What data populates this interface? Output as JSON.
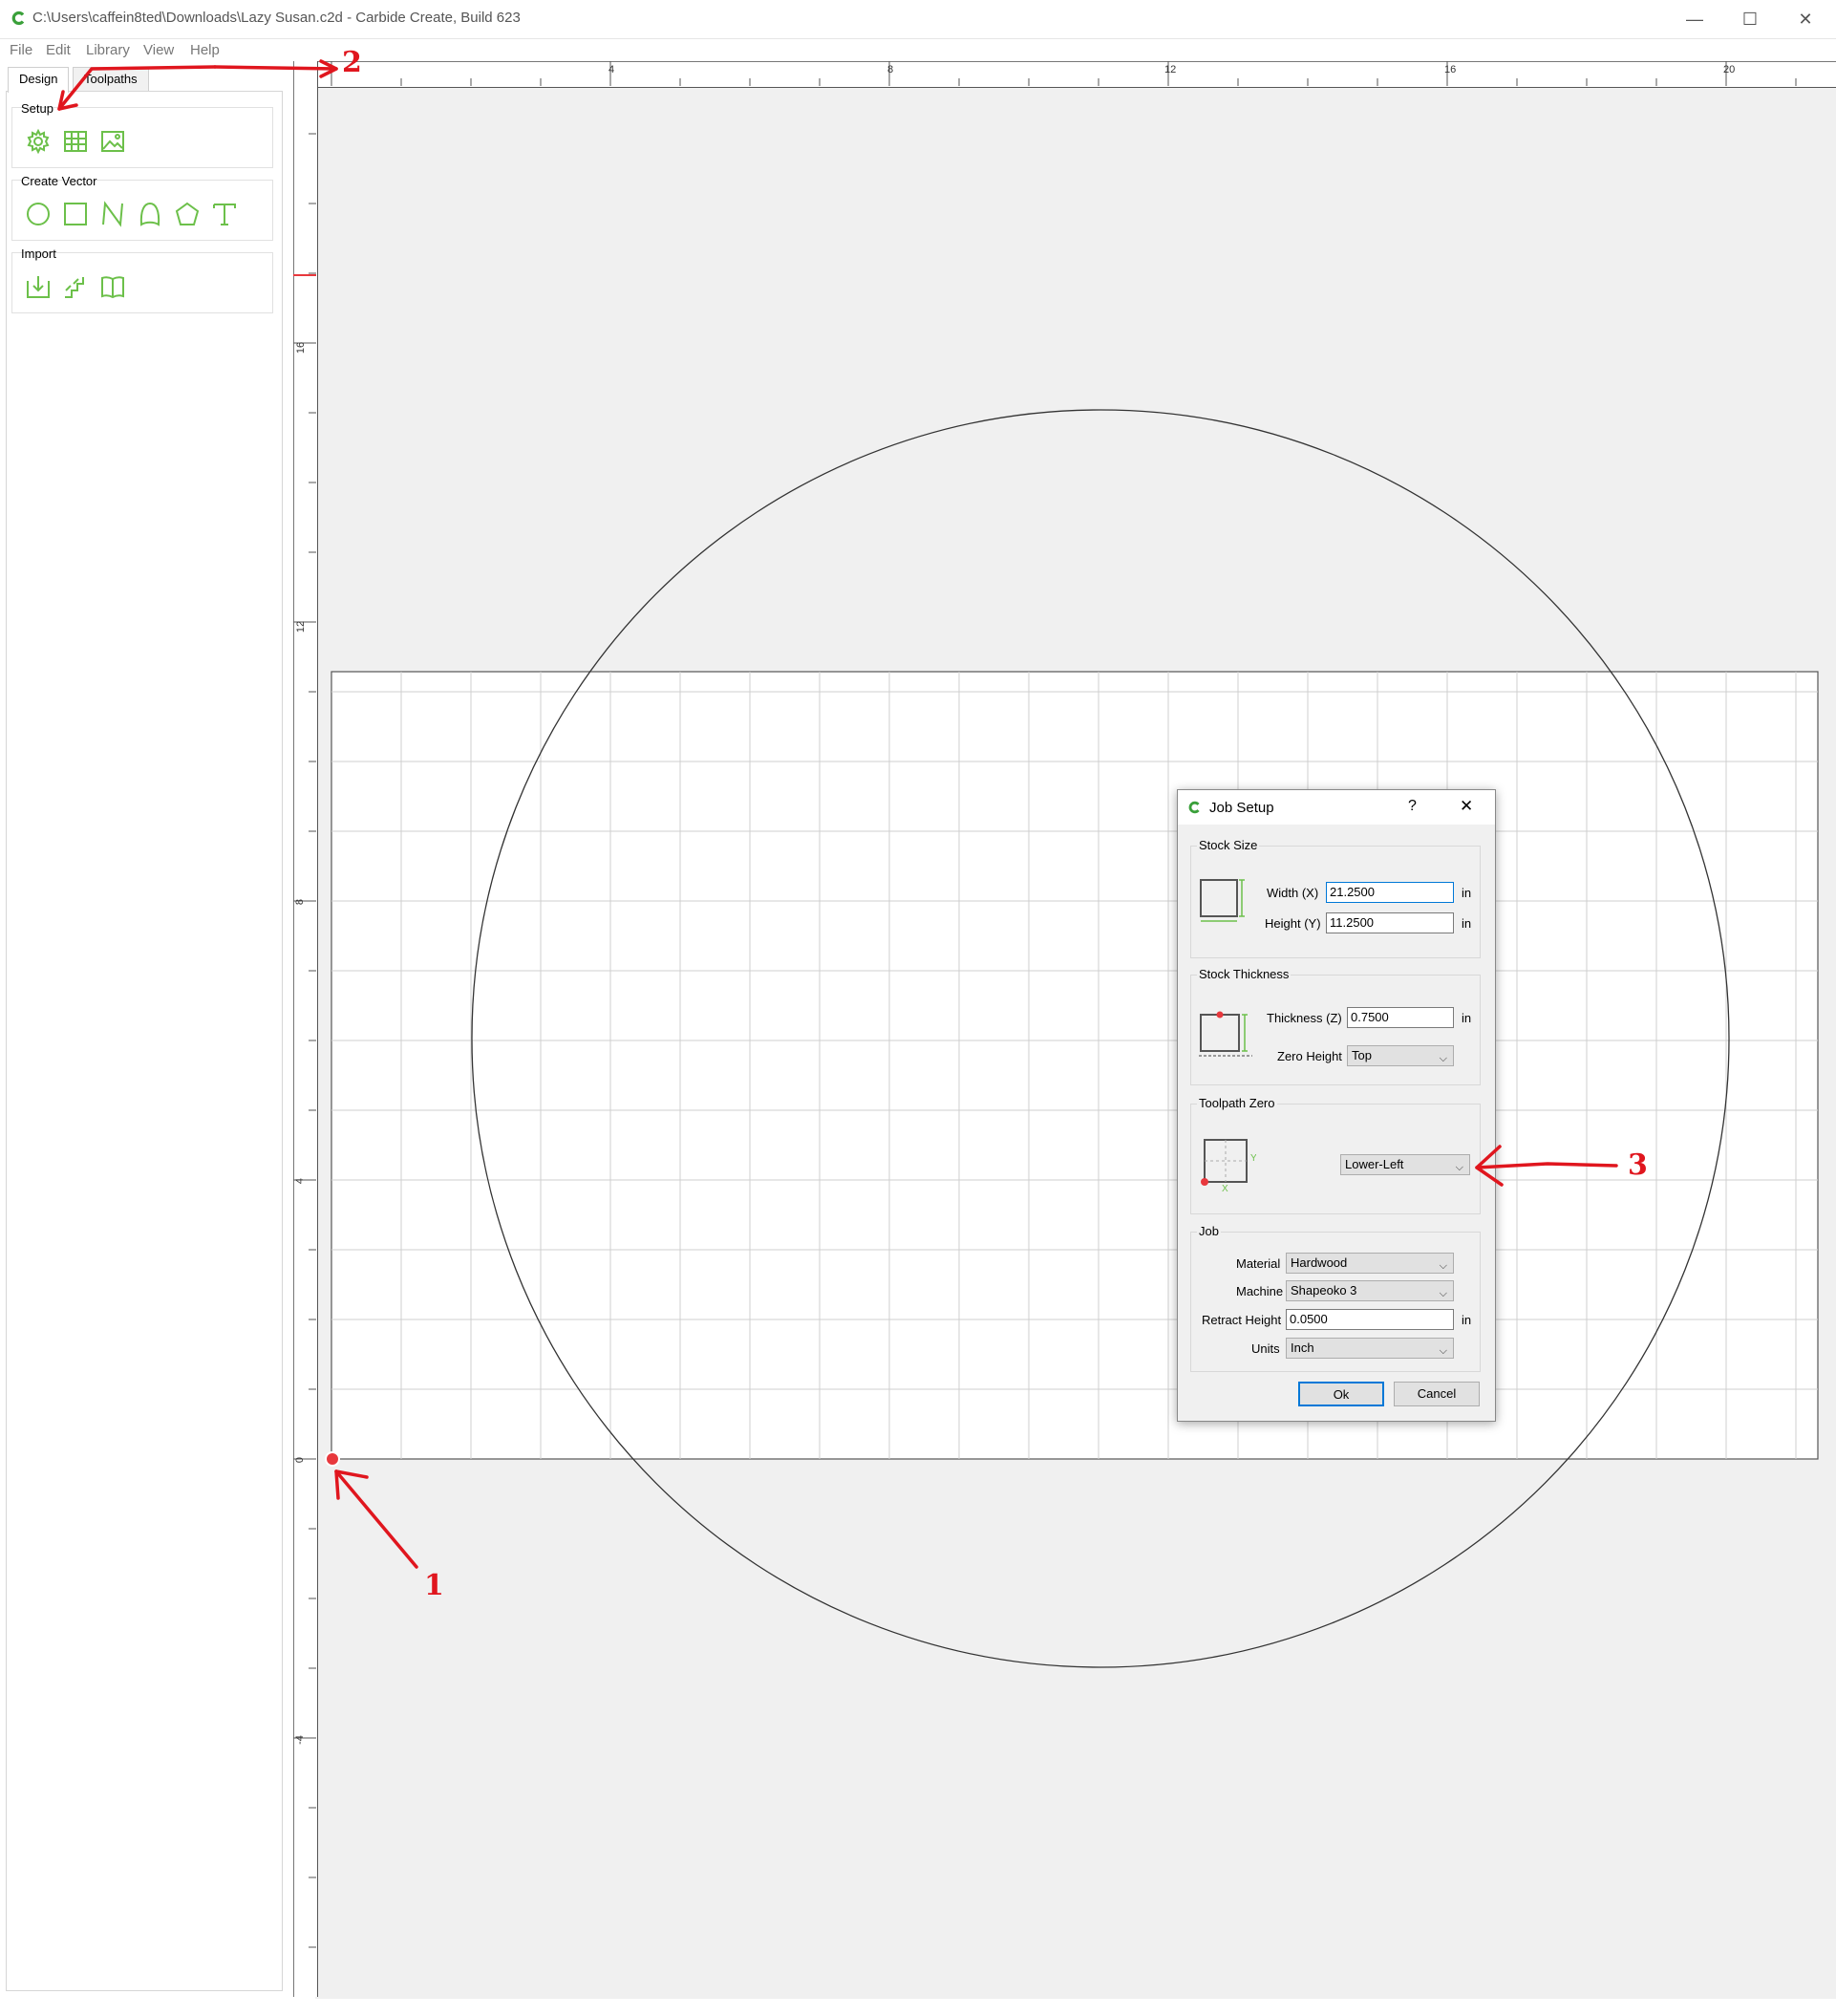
{
  "window": {
    "title": "C:\\Users\\caffein8ted\\Downloads\\Lazy Susan.c2d - Carbide Create, Build 623",
    "minimize": "—",
    "maximize": "☐",
    "close": "✕"
  },
  "menu": [
    "File",
    "Edit",
    "Library",
    "View",
    "Help"
  ],
  "tabs": {
    "design": "Design",
    "toolpaths": "Toolpaths"
  },
  "groups": {
    "setup": {
      "label": "Setup",
      "icons": [
        "job-setup-gear-icon",
        "grid-icon",
        "image-icon"
      ]
    },
    "create_vector": {
      "label": "Create Vector",
      "icons": [
        "circle-icon",
        "rectangle-icon",
        "polyline-icon",
        "curve-icon",
        "polygon-icon",
        "text-icon"
      ]
    },
    "import": {
      "label": "Import",
      "icons": [
        "import-vector-icon",
        "import-steps-icon",
        "library-book-icon"
      ]
    }
  },
  "ruler": {
    "top_labels": [
      "4",
      "8",
      "12",
      "16",
      "20"
    ],
    "left_labels": [
      "16",
      "12",
      "8",
      "4",
      "0",
      "-4"
    ]
  },
  "dialog": {
    "title": "Job Setup",
    "help": "?",
    "close": "✕",
    "stock_size": {
      "label": "Stock Size",
      "width_label": "Width (X)",
      "width_value": "21.2500",
      "height_label": "Height (Y)",
      "height_value": "11.2500",
      "unit": "in"
    },
    "stock_thickness": {
      "label": "Stock Thickness",
      "thickness_label": "Thickness (Z)",
      "thickness_value": "0.7500",
      "unit": "in",
      "zero_height_label": "Zero Height",
      "zero_height_value": "Top"
    },
    "toolpath_zero": {
      "label": "Toolpath Zero",
      "value": "Lower-Left"
    },
    "job": {
      "label": "Job",
      "material_label": "Material",
      "material_value": "Hardwood",
      "machine_label": "Machine",
      "machine_value": "Shapeoko 3",
      "retract_label": "Retract Height",
      "retract_value": "0.0500",
      "retract_unit": "in",
      "units_label": "Units",
      "units_value": "Inch"
    },
    "ok": "Ok",
    "cancel": "Cancel"
  },
  "annotations": [
    "1",
    "2",
    "3"
  ],
  "colors": {
    "accent_green": "#6cc04a",
    "annotation_red": "#e0161e",
    "origin_red": "#e8383d"
  }
}
